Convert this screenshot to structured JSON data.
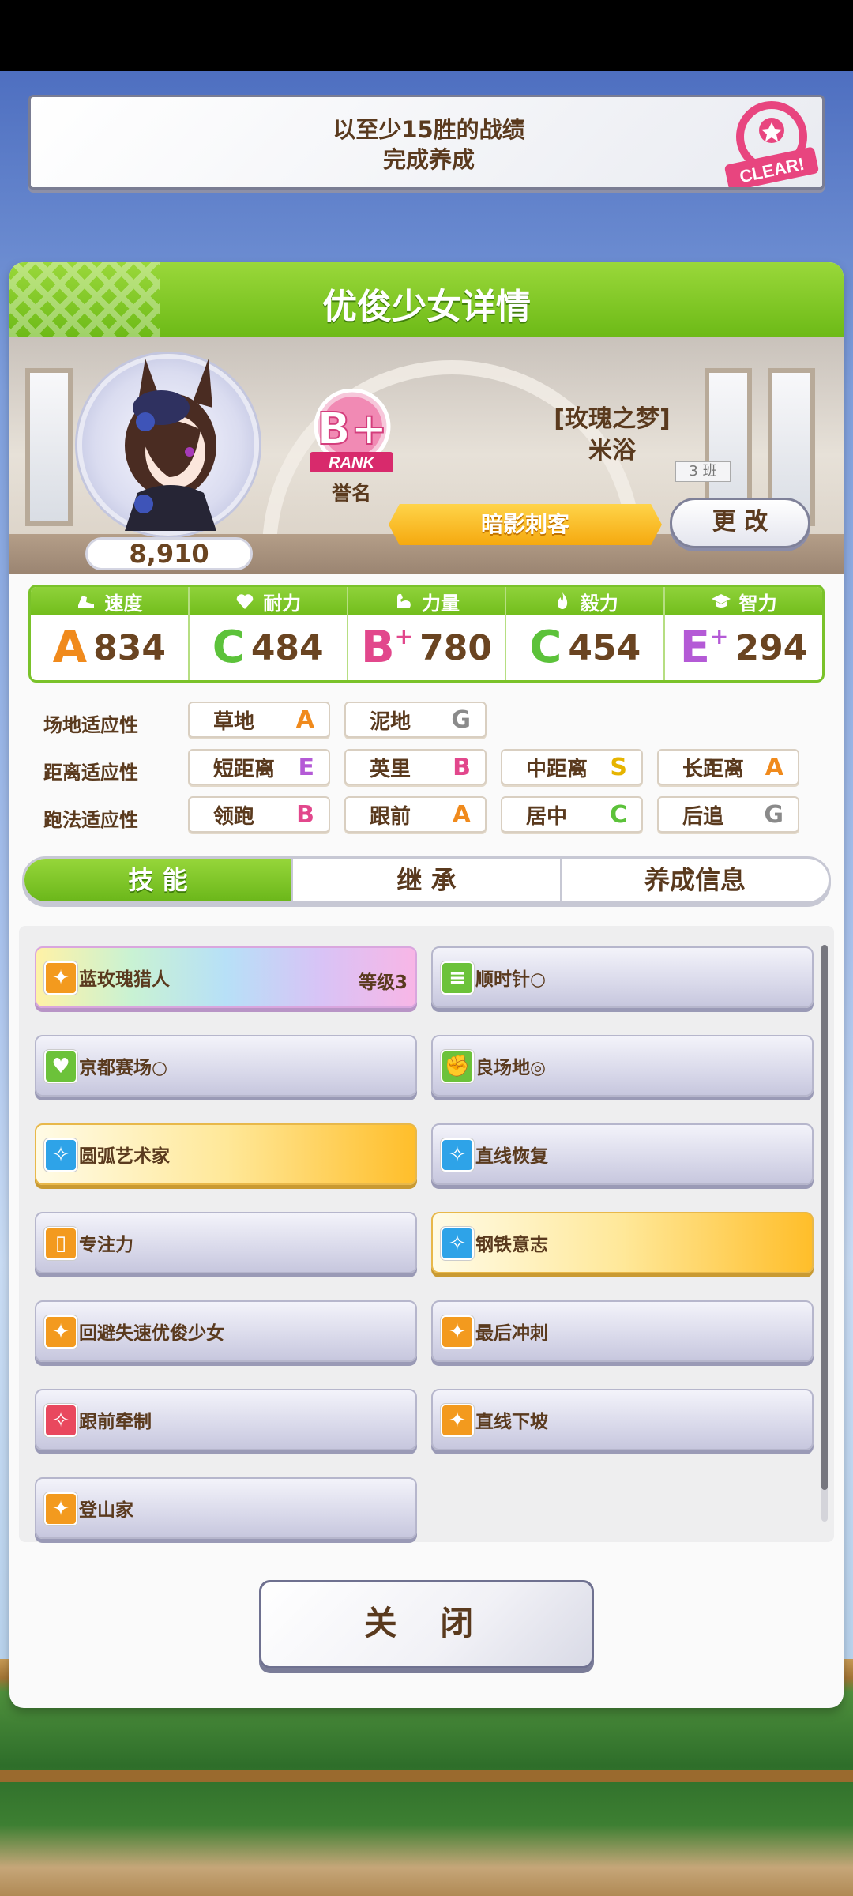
{
  "mission": {
    "line1": "以至少15胜的战绩",
    "line2": "完成养成",
    "stamp": "CLEAR!"
  },
  "panel": {
    "title": "优俊少女详情"
  },
  "character": {
    "score": "8,910",
    "rank": "B+",
    "rank_word": "RANK",
    "rank_label": "誉名",
    "title": "[玫瑰之梦]",
    "name": "米浴",
    "class_tag": "3 班",
    "epithet": "暗影刺客",
    "change_button": "更 改"
  },
  "stats": [
    {
      "label": "速度",
      "grade": "A",
      "plus": "",
      "value": "834",
      "color": "#f08a1c",
      "icon": "shoe-icon"
    },
    {
      "label": "耐力",
      "grade": "C",
      "plus": "",
      "value": "484",
      "color": "#5cc23a",
      "icon": "heart-icon"
    },
    {
      "label": "力量",
      "grade": "B",
      "plus": "+",
      "value": "780",
      "color": "#e2478c",
      "icon": "muscle-icon"
    },
    {
      "label": "毅力",
      "grade": "C",
      "plus": "",
      "value": "454",
      "color": "#5cc23a",
      "icon": "flame-icon"
    },
    {
      "label": "智力",
      "grade": "E",
      "plus": "+",
      "value": "294",
      "color": "#b45ad6",
      "icon": "graduation-cap-icon"
    }
  ],
  "aptitude": {
    "track_label": "场地适应性",
    "distance_label": "距离适应性",
    "style_label": "跑法适应性",
    "track": [
      {
        "name": "草地",
        "grade": "A",
        "color": "#f08a1c"
      },
      {
        "name": "泥地",
        "grade": "G",
        "color": "#8a8a8a"
      }
    ],
    "distance": [
      {
        "name": "短距离",
        "grade": "E",
        "color": "#b45ad6"
      },
      {
        "name": "英里",
        "grade": "B",
        "color": "#e2478c"
      },
      {
        "name": "中距离",
        "grade": "S",
        "color": "#e6b400"
      },
      {
        "name": "长距离",
        "grade": "A",
        "color": "#f08a1c"
      }
    ],
    "style": [
      {
        "name": "领跑",
        "grade": "B",
        "color": "#e2478c"
      },
      {
        "name": "跟前",
        "grade": "A",
        "color": "#f08a1c"
      },
      {
        "name": "居中",
        "grade": "C",
        "color": "#5cc23a"
      },
      {
        "name": "后追",
        "grade": "G",
        "color": "#8a8a8a"
      }
    ]
  },
  "tabs": [
    "技 能",
    "继 承",
    "养成信息"
  ],
  "skills": [
    {
      "name": "蓝玫瑰猎人",
      "level": "等级3",
      "style": "rainbow",
      "icon_color": "#f39a1e",
      "icon": "dash-icon"
    },
    {
      "name": "顺时针○",
      "level": "",
      "style": "normal",
      "icon_color": "#6cc23a",
      "icon": "list-icon"
    },
    {
      "name": "京都赛场○",
      "level": "",
      "style": "normal",
      "icon_color": "#6cc23a",
      "icon": "heart-icon"
    },
    {
      "name": "良场地◎",
      "level": "",
      "style": "normal",
      "icon_color": "#6cc23a",
      "icon": "muscle-icon"
    },
    {
      "name": "圆弧艺术家",
      "level": "",
      "style": "gold",
      "icon_color": "#2ea3e8",
      "icon": "sparkle-icon"
    },
    {
      "name": "直线恢复",
      "level": "",
      "style": "normal",
      "icon_color": "#2ea3e8",
      "icon": "sparkle-icon"
    },
    {
      "name": "专注力",
      "level": "",
      "style": "normal",
      "icon_color": "#f39a1e",
      "icon": "gate-icon"
    },
    {
      "name": "钢铁意志",
      "level": "",
      "style": "gold",
      "icon_color": "#2ea3e8",
      "icon": "sparkle-icon"
    },
    {
      "name": "回避失速优俊少女",
      "level": "",
      "style": "normal",
      "icon_color": "#f39a1e",
      "icon": "dash-icon"
    },
    {
      "name": "最后冲刺",
      "level": "",
      "style": "normal",
      "icon_color": "#f39a1e",
      "icon": "dash-icon"
    },
    {
      "name": "跟前牵制",
      "level": "",
      "style": "normal",
      "icon_color": "#e9485e",
      "icon": "sparkle-icon"
    },
    {
      "name": "直线下坡",
      "level": "",
      "style": "normal",
      "icon_color": "#f39a1e",
      "icon": "dash-icon"
    },
    {
      "name": "登山家",
      "level": "",
      "style": "normal",
      "icon_color": "#f39a1e",
      "icon": "dash-icon"
    }
  ],
  "close_button": "关 闭"
}
